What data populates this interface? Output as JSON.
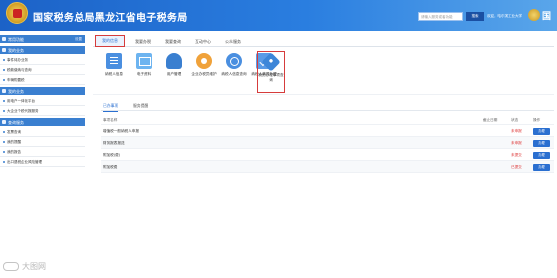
{
  "header": {
    "title": "国家税务总局黑龙江省电子税务局",
    "search_placeholder": "请输入服务或者功能",
    "search_button": "搜索",
    "user_text": "欢迎，哈尔滨工业大学",
    "cut_text": "国"
  },
  "sidebar": {
    "groups": [
      {
        "title": "常用功能",
        "more": "设置",
        "items": []
      },
      {
        "title": "我的业务",
        "items": [
          "事件待办业务",
          "税款缴纳与查询",
          "车辆购置税"
        ]
      },
      {
        "title": "我的业务",
        "items": [
          "用电户一体化平台",
          "大企业个税代报服务"
        ]
      },
      {
        "title": "查询服务",
        "items": [
          "发票查询",
          "我的提醒",
          "我的报告",
          "出口退税企业风险管理"
        ]
      }
    ]
  },
  "main": {
    "tabs": [
      "我的信息",
      "我要办税",
      "我要查询",
      "互动中心",
      "公众服务"
    ],
    "active_tab": "我的信息",
    "apps": [
      {
        "label": "纳税人信息",
        "icon": "document-icon"
      },
      {
        "label": "电子资料",
        "icon": "mail-icon"
      },
      {
        "label": "用户管理",
        "icon": "users-icon"
      },
      {
        "label": "企业办税员维护",
        "icon": "gear-icon"
      },
      {
        "label": "纳税人信息查询",
        "icon": "search-icon"
      },
      {
        "label": "纳税人事项办理",
        "icon": "task-icon"
      },
      {
        "label": "我的办理事项查询",
        "icon": "tag-icon"
      }
    ],
    "subtabs": [
      "已办事项",
      "服务提醒"
    ],
    "table": {
      "headers": [
        "事项名称",
        "截止日期",
        "状态",
        "操作"
      ],
      "rows": [
        {
          "name": "增值税一般纳税人申报",
          "date": "",
          "status": "未申报",
          "action": "办理"
        },
        {
          "name": "财务报表报送",
          "date": "",
          "status": "未申报",
          "action": "办理"
        },
        {
          "name": "附加税(费)",
          "date": "",
          "status": "未提交",
          "action": "办理"
        },
        {
          "name": "附加税费",
          "date": "",
          "status": "已提交",
          "action": "办理"
        }
      ]
    }
  },
  "watermark": "大图网"
}
